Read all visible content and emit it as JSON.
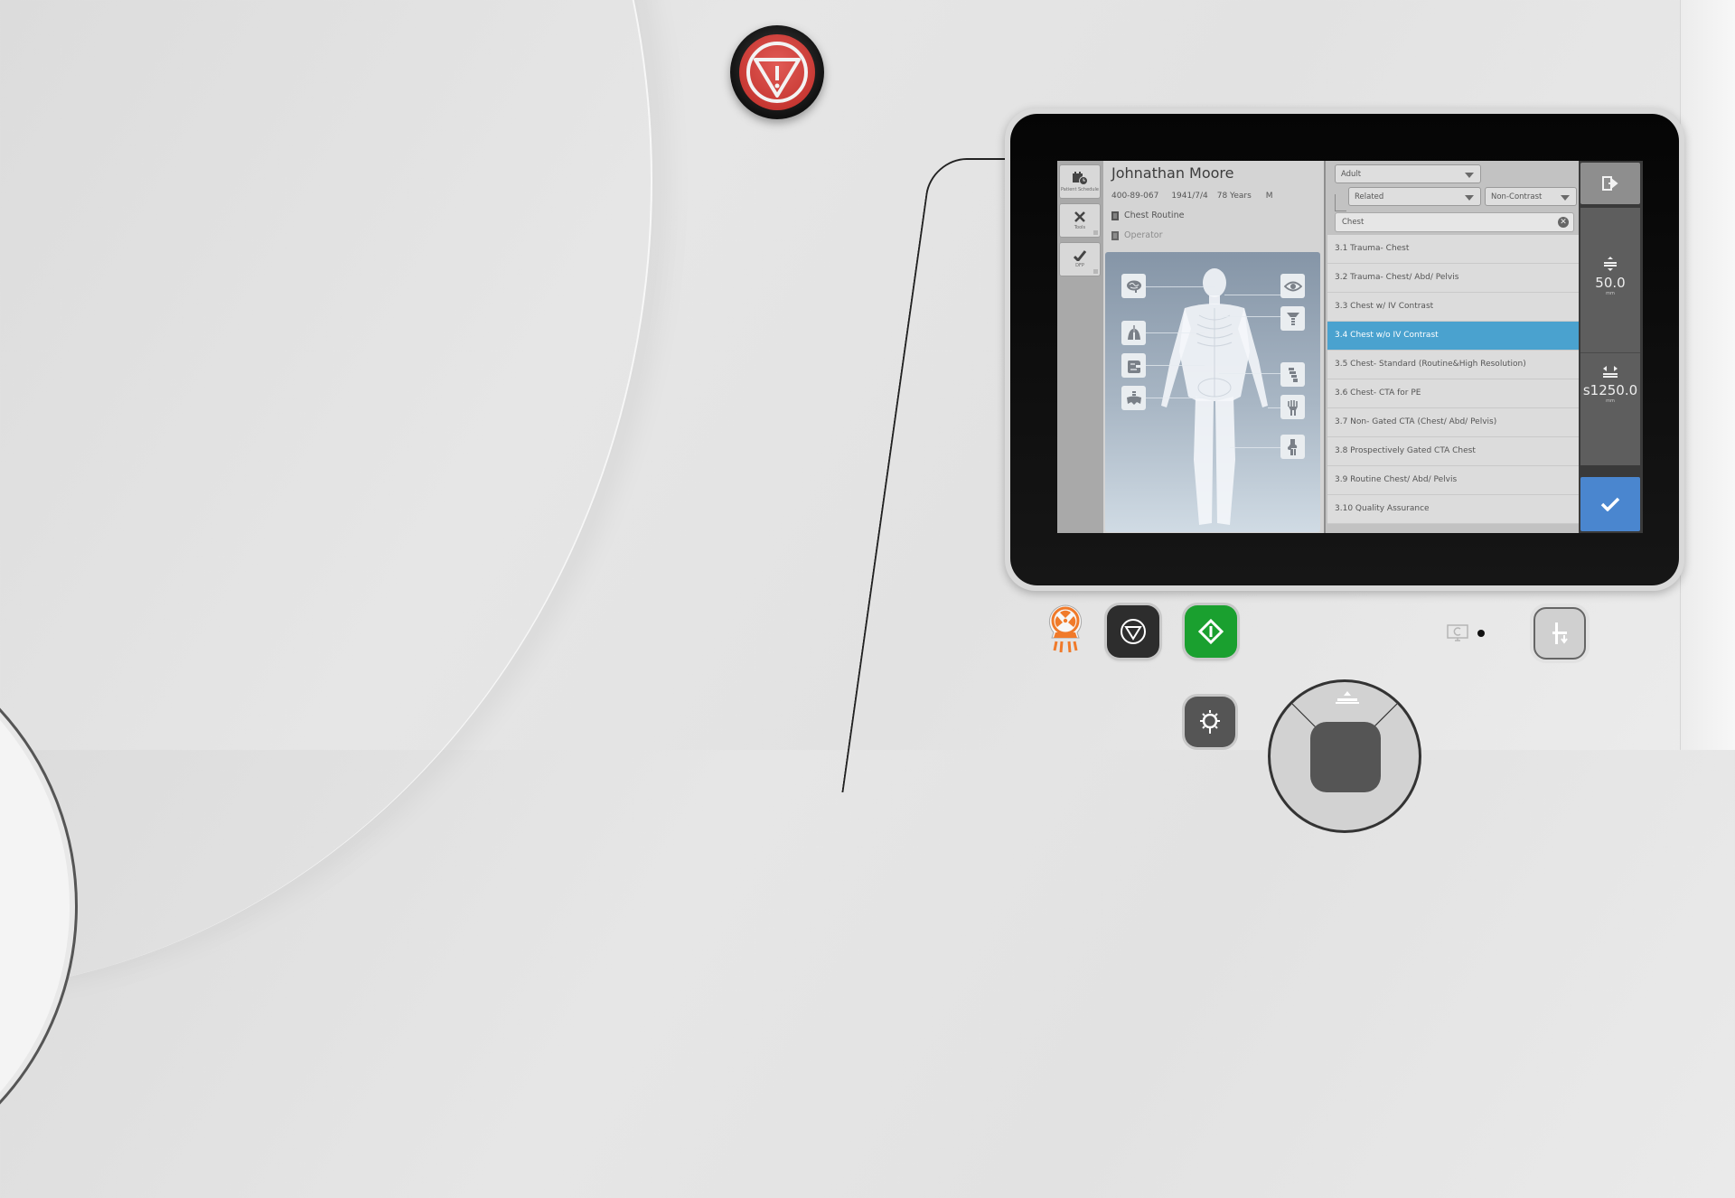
{
  "device": {
    "emergency_stop_icon": "emergency-stop-triangle-icon",
    "status_indicator_icon": "monitor-refresh-icon"
  },
  "nav": {
    "items": [
      {
        "label": "Patient Schedule",
        "icon": "calendar-clock-icon"
      },
      {
        "label": "Tools",
        "icon": "tools-icon"
      },
      {
        "label": "DFP",
        "icon": "check-icon"
      }
    ]
  },
  "patient": {
    "name": "Johnathan Moore",
    "id": "400-89-067",
    "dob": "1941/7/4",
    "age": "78 Years",
    "sex": "M",
    "protocol": "Chest  Routine",
    "operator": "Operator"
  },
  "body_map": {
    "left_regions": [
      "brain",
      "lungs",
      "abdomen",
      "pelvis"
    ],
    "right_regions": [
      "eye",
      "neck",
      "spine",
      "hand",
      "knee"
    ]
  },
  "filters": {
    "age_group": "Adult",
    "relation": "Related",
    "contrast": "Non-Contrast",
    "search_value": "Chest"
  },
  "protocol_list": {
    "selected_index": 3,
    "items": [
      "3.1 Trauma- Chest",
      "3.2 Trauma- Chest/ Abd/ Pelvis",
      "3.3 Chest w/ IV Contrast",
      "3.4 Chest w/o IV Contrast",
      "3.5 Chest- Standard (Routine&High Resolution)",
      "3.6 Chest- CTA for PE",
      "3.7 Non- Gated CTA  (Chest/ Abd/ Pelvis)",
      "3.8 Prospectively Gated CTA Chest",
      "3.9 Routine Chest/ Abd/ Pelvis",
      "3.10 Quality Assurance"
    ]
  },
  "table": {
    "height_value": "50.0",
    "height_unit": "mm",
    "position_value": "s1250.0",
    "position_unit": "mm"
  },
  "colors": {
    "selected_row": "#4aa2cf",
    "confirm": "#4a86cf",
    "start_button": "#1aa02f",
    "radiation": "#f07a2a",
    "estop": "#c63631"
  }
}
